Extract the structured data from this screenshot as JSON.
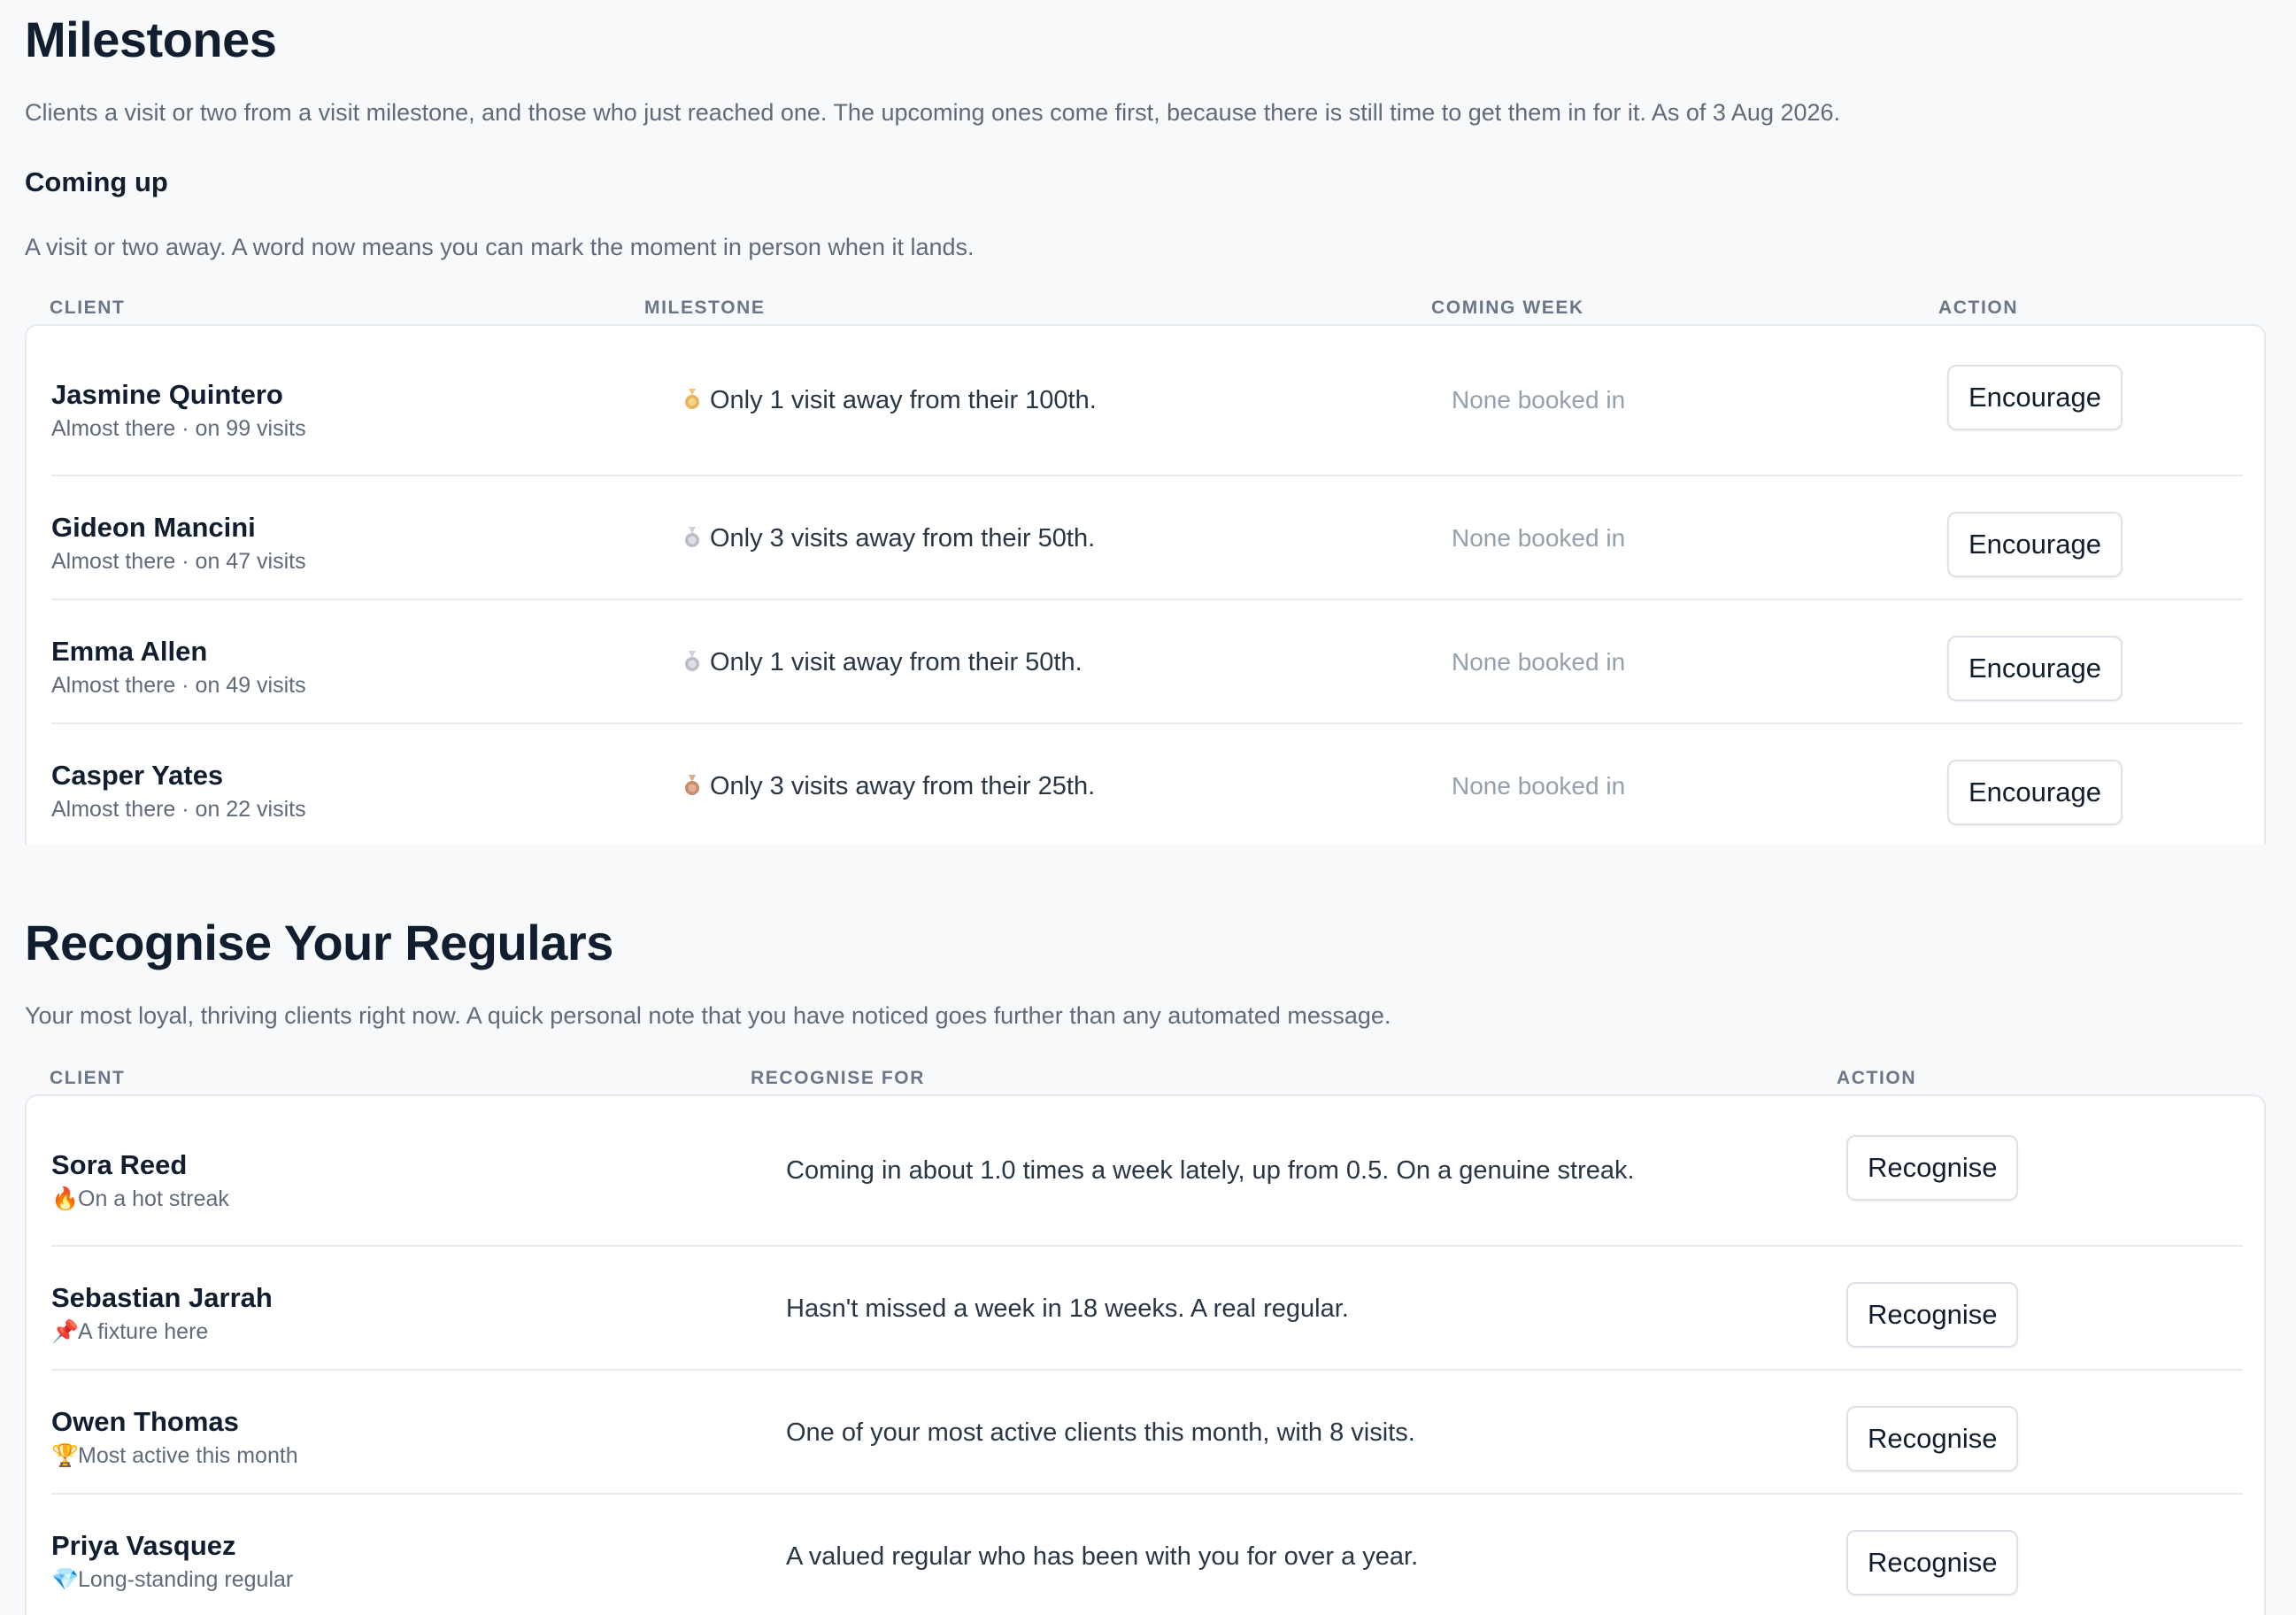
{
  "milestones": {
    "title": "Milestones",
    "description": "Clients a visit or two from a visit milestone, and those who just reached one. The upcoming ones come first, because there is still time to get them in for it. As of 3 Aug 2026.",
    "coming_up": {
      "heading": "Coming up",
      "description": "A visit or two away. A word now means you can mark the moment in person when it lands.",
      "columns": [
        "CLIENT",
        "MILESTONE",
        "COMING WEEK",
        "ACTION"
      ],
      "rows": [
        {
          "name": "Jasmine Quintero",
          "status": "Almost there · on 99 visits",
          "medal": "gold-medal-icon",
          "milestone": "Only 1 visit away from their 100th.",
          "coming_week": "None booked in",
          "action": "Encourage"
        },
        {
          "name": "Gideon Mancini",
          "status": "Almost there · on 47 visits",
          "medal": "silver-medal-icon",
          "milestone": "Only 3 visits away from their 50th.",
          "coming_week": "None booked in",
          "action": "Encourage"
        },
        {
          "name": "Emma Allen",
          "status": "Almost there · on 49 visits",
          "medal": "silver-medal-icon",
          "milestone": "Only 1 visit away from their 50th.",
          "coming_week": "None booked in",
          "action": "Encourage"
        },
        {
          "name": "Casper Yates",
          "status": "Almost there · on 22 visits",
          "medal": "bronze-medal-icon",
          "milestone": "Only 3 visits away from their 25th.",
          "coming_week": "None booked in",
          "action": "Encourage"
        }
      ]
    }
  },
  "regulars": {
    "title": "Recognise Your Regulars",
    "description": "Your most loyal, thriving clients right now. A quick personal note that you have noticed goes further than any automated message.",
    "columns": [
      "CLIENT",
      "RECOGNISE FOR",
      "ACTION"
    ],
    "rows": [
      {
        "name": "Sora Reed",
        "badge_icon": "fire-icon",
        "badge_glyph": "🔥",
        "badge": "On a hot streak",
        "reason": "Coming in about 1.0 times a week lately, up from 0.5. On a genuine streak.",
        "action": "Recognise"
      },
      {
        "name": "Sebastian Jarrah",
        "badge_icon": "pushpin-icon",
        "badge_glyph": "📌",
        "badge": "A fixture here",
        "reason": "Hasn't missed a week in 18 weeks. A real regular.",
        "action": "Recognise"
      },
      {
        "name": "Owen Thomas",
        "badge_icon": "trophy-icon",
        "badge_glyph": "🏆",
        "badge": "Most active this month",
        "reason": "One of your most active clients this month, with 8 visits.",
        "action": "Recognise"
      },
      {
        "name": "Priya Vasquez",
        "badge_icon": "gem-icon",
        "badge_glyph": "💎",
        "badge": "Long-standing regular",
        "reason": "A valued regular who has been with you for over a year.",
        "action": "Recognise"
      }
    ]
  },
  "colors": {
    "gold": "#e7b45a",
    "silver": "#b9bec6",
    "bronze": "#c98d6a",
    "fire": "#f05a28",
    "pin": "#d93a3a",
    "trophy": "#d99a22",
    "gem": "#3a9ad9"
  }
}
